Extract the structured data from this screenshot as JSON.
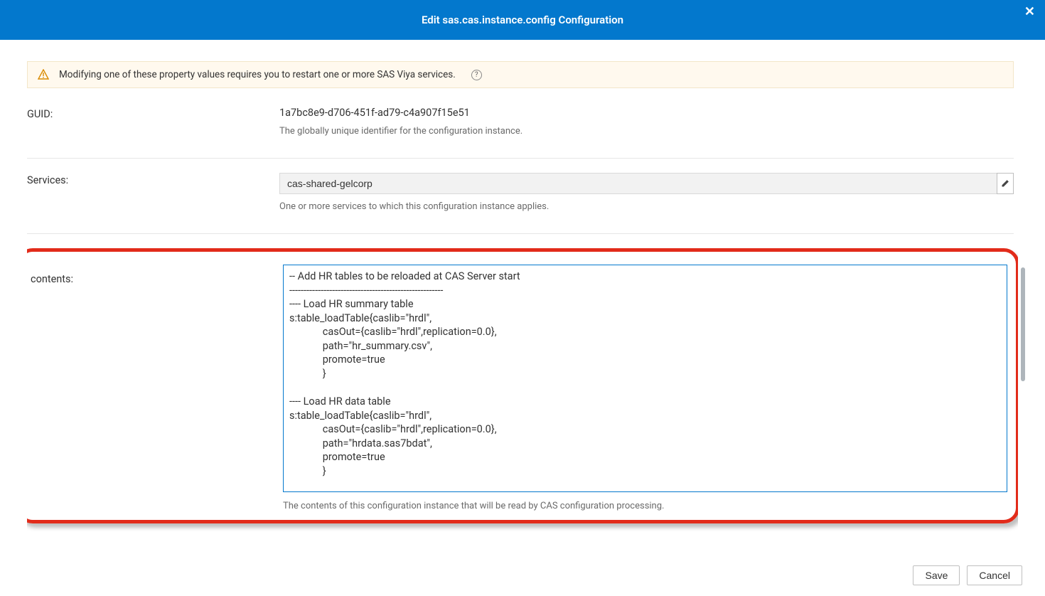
{
  "header": {
    "title": "Edit sas.cas.instance.config Configuration"
  },
  "warning": {
    "text": "Modifying one of these property values requires you to restart one or more SAS Viya services."
  },
  "fields": {
    "guid": {
      "label": "GUID:",
      "value": "1a7bc8e9-d706-451f-ad79-c4a907f15e51",
      "desc": "The globally unique identifier for the configuration instance."
    },
    "services": {
      "label": "Services:",
      "value": "cas-shared-gelcorp",
      "desc": "One or more services to which this configuration instance applies."
    },
    "contents": {
      "label": "contents:",
      "value": "-- Add HR tables to be reloaded at CAS Server start\n------------------------------------------------------\n---- Load HR summary table\ns:table_loadTable{caslib=\"hrdl\",\n             casOut={caslib=\"hrdl\",replication=0.0},\n             path=\"hr_summary.csv\",\n             promote=true\n             }\n\n---- Load HR data table\ns:table_loadTable{caslib=\"hrdl\",\n             casOut={caslib=\"hrdl\",replication=0.0},\n             path=\"hrdata.sas7bdat\",\n             promote=true\n             }\n",
      "desc": "The contents of this configuration instance that will be read by CAS configuration processing."
    }
  },
  "buttons": {
    "save": "Save",
    "cancel": "Cancel"
  }
}
